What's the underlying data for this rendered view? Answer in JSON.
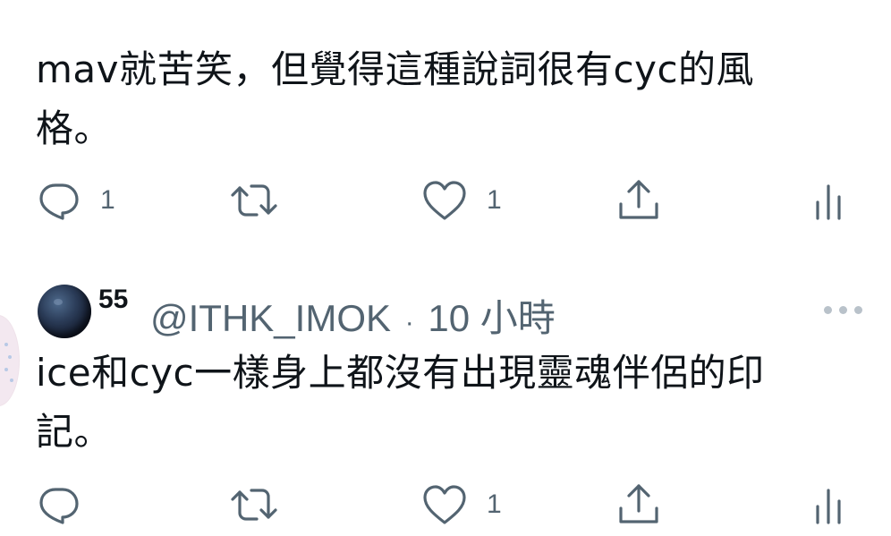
{
  "tweets": [
    {
      "text": "mav就苦笑，但覺得這種說詞很有cyc的風\n格。",
      "actions": {
        "reply_count": "1",
        "retweet_count": "",
        "like_count": "1"
      }
    },
    {
      "author": {
        "display_name": "55",
        "handle": "@ITHK_IMOK",
        "separator": "·",
        "time": "10 小時"
      },
      "text": "ice和cyc一樣身上都沒有出現靈魂伴侶的印\n記。",
      "actions": {
        "reply_count": "",
        "retweet_count": "",
        "like_count": "1"
      }
    }
  ],
  "icons": {
    "reply": "reply-icon",
    "retweet": "retweet-icon",
    "like": "heart-icon",
    "share": "share-icon",
    "views": "views-icon",
    "more": "more-icon"
  },
  "colors": {
    "text": "#0f1419",
    "secondary": "#536471",
    "avatar": "#1a2438"
  }
}
